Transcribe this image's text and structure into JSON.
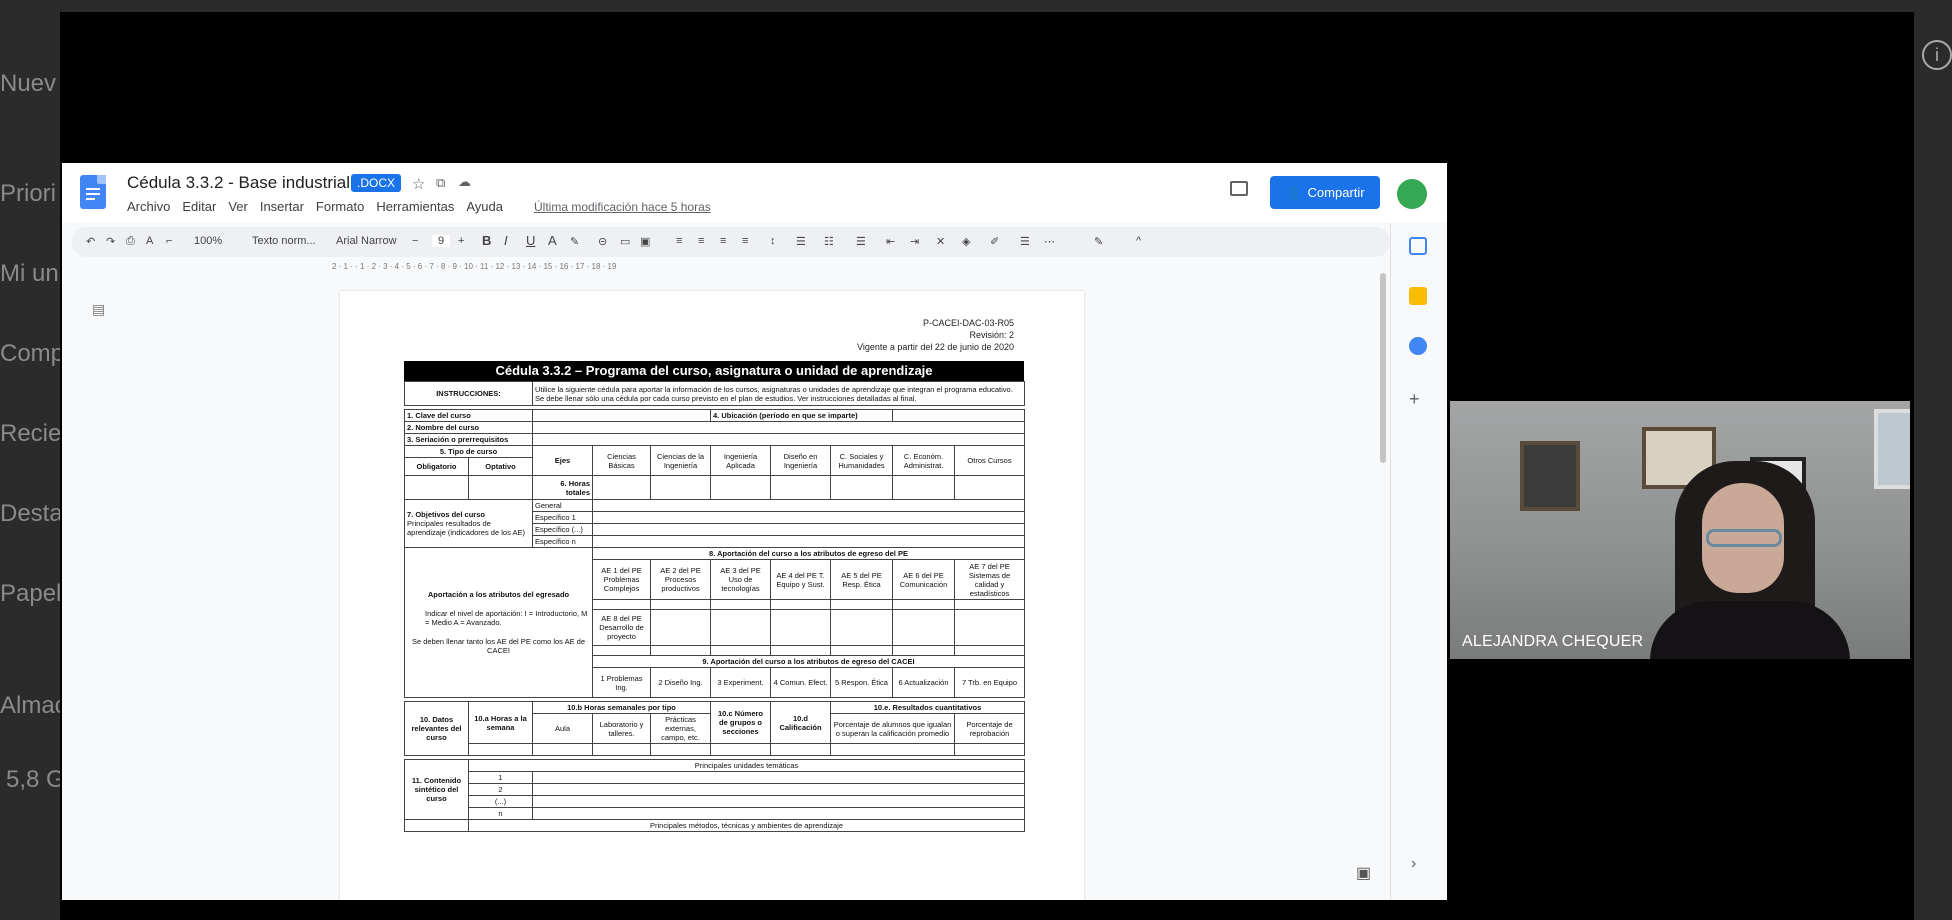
{
  "background_nav": [
    "Nuev",
    "Priori",
    "Mi un",
    "Comp",
    "Recie",
    "Desta",
    "Papel",
    "Almac",
    "5,8 G"
  ],
  "doc": {
    "title": "Cédula 3.3.2 - Base industrial",
    "badge": ".DOCX",
    "menus": [
      "Archivo",
      "Editar",
      "Ver",
      "Insertar",
      "Formato",
      "Herramientas",
      "Ayuda"
    ],
    "last_modified": "Última modificación hace 5 horas",
    "share_label": "Compartir",
    "toolbar": {
      "zoom": "100%",
      "style": "Texto norm...",
      "font": "Arial Narrow",
      "size": "9"
    },
    "ruler": "2 · 1 · · 1 · 2 · 3 · 4 · 5 · 6 · 7 · 8 · 9 · 10 · 11 · 12 · 13 · 14 · 15 · 16 · 17 · 18 · 19"
  },
  "page": {
    "header_lines": [
      "P-CACEI-DAC-03-R05",
      "Revisión: 2",
      "Vigente a partir del 22 de junio de 2020"
    ],
    "form_title": "Cédula 3.3.2 – Programa del curso, asignatura o unidad de aprendizaje",
    "instr_label": "INSTRUCCIONES:",
    "instr_text": "Utilice la siguiente cédula para aportar la información de los cursos, asignaturas o unidades de aprendizaje que integran el programa educativo. Se debe llenar sólo una cédula por cada curso previsto en el plan de estudios. Ver instrucciones detalladas al final.",
    "r1": "1. Clave del curso",
    "r4": "4. Ubicación (período en que se imparte)",
    "r2": "2. Nombre del curso",
    "r3": "3. Seriación o prerrequisitos",
    "r5": "5. Tipo de curso",
    "oblig": "Obligatorio",
    "opt": "Optativo",
    "ejes": "Ejes",
    "ejes_cols": [
      "Ciencias Básicas",
      "Ciencias de la Ingeniería",
      "Ingeniería Aplicada",
      "Diseño en Ingeniería",
      "C. Sociales y Humanidades",
      "C. Económ. Administrat.",
      "Otros Cursos"
    ],
    "horas": "6. Horas totales",
    "r7": "7. Objetivos del curso",
    "r7b": "Principales resultados de aprendizaje (indicadores de los AE)",
    "obj_rows": [
      "General",
      "Específico 1",
      "Específico (...)",
      "Específico n"
    ],
    "s8": "8. Aportación del curso a los atributos de egreso del PE",
    "aport_label": "Aportación a los atributos del egresado",
    "nivel": "Indicar el nivel de aportación: I = Introductorio, M = Medio A = Avanzado.",
    "llenar": "Se deben llenar tanto los AE del PE como los AE de CACEI",
    "ae_cols": [
      "AE 1 del PE Problemas Complejos",
      "AE 2 del PE Procesos productivos",
      "AE 3 del PE Uso de tecnologías",
      "AE 4 del PE T. Equipo y Sust.",
      "AE 5 del PE Resp. Ética",
      "AE 6 del PE Comunicación",
      "AE 7 del PE Sistemas de calidad y estadísticos"
    ],
    "ae8": "AE 8 del PE Desarrollo de proyecto",
    "s9": "9. Aportación del curso a los atributos de egreso del CACEI",
    "cacei_cols": [
      "1 Problemas Ing.",
      "2 Diseño Ing.",
      "3 Experiment.",
      "4 Comun. Efect.",
      "5 Respon. Ética",
      "6 Actualización",
      "7 Trb. en Equipo"
    ],
    "r10": "10. Datos relevantes del curso",
    "r10a": "10.a Horas a la semana",
    "r10b": "10.b Horas semanales por tipo",
    "aula": "Aula",
    "lab": "Laboratorio y talleres.",
    "pract": "Prácticas externas, campo, etc.",
    "r10c": "10.c Número de grupos o secciones",
    "r10d": "10.d Calificación",
    "r10e": "10.e. Resultados cuantitativos",
    "pct1": "Porcentaje de alumnos que igualan o superan la calificación promedio",
    "pct2": "Porcentaje de reprobación",
    "r11": "11. Contenido sintético del curso",
    "unidades": "Principales unidades temáticas",
    "unit_rows": [
      "1",
      "2",
      "(...)",
      "n"
    ],
    "metodos": "Principales métodos, técnicas y ambientes de aprendizaje"
  },
  "video": {
    "name": "ALEJANDRA CHEQUER"
  },
  "colors": {
    "share": "#1a73e8",
    "avatar": "#34a853",
    "docs_blue": "#4285f4"
  }
}
